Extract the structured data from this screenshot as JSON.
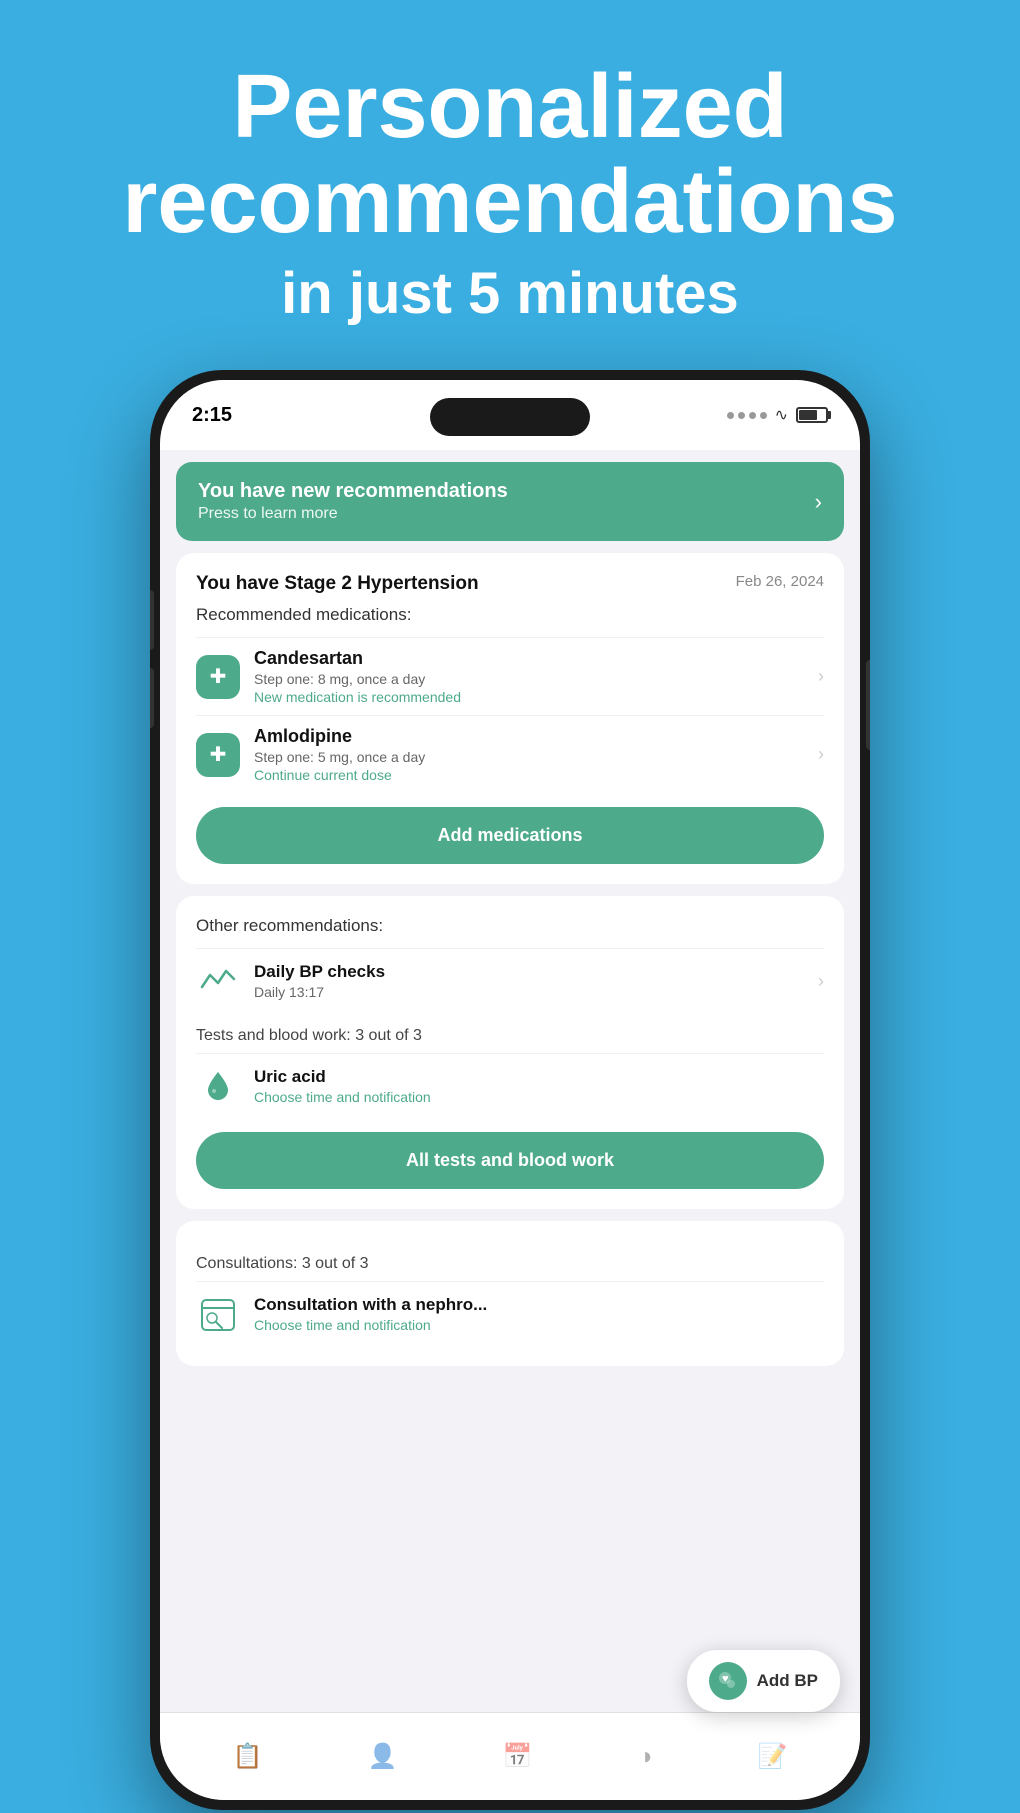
{
  "hero": {
    "title": "Personalized recommendations",
    "subtitle": "in just 5 minutes"
  },
  "status_bar": {
    "time": "2:15"
  },
  "banner": {
    "title": "You have new recommendations",
    "subtitle": "Press to learn more"
  },
  "hypertension_card": {
    "diagnosis": "You have Stage 2 Hypertension",
    "date": "Feb 26, 2024",
    "section_label": "Recommended medications:",
    "medications": [
      {
        "name": "Candesartan",
        "dose": "Step one: 8 mg, once a day",
        "status": "New medication is recommended",
        "status_type": "new"
      },
      {
        "name": "Amlodipine",
        "dose": "Step one: 5 mg, once a day",
        "status": "Continue current dose",
        "status_type": "continue"
      }
    ],
    "add_button": "Add medications"
  },
  "other_recommendations_card": {
    "section_label": "Other recommendations:",
    "bp_item": {
      "name": "Daily BP checks",
      "schedule": "Daily 13:17"
    },
    "tests_label": "Tests and blood work: 3 out of 3",
    "uric_item": {
      "name": "Uric acid",
      "action": "Choose time and notification"
    },
    "all_tests_button": "All tests and blood work"
  },
  "consultations_card": {
    "label": "Consultations: 3 out of 3",
    "item": {
      "name": "Consultation with a nephro...",
      "action": "Choose time and notification"
    }
  },
  "add_bp_button": "Add BP",
  "bottom_nav": {
    "items": [
      {
        "label": "",
        "icon": "clipboard"
      },
      {
        "label": "",
        "icon": "person"
      },
      {
        "label": "",
        "icon": "calendar"
      },
      {
        "label": "",
        "icon": "chart"
      },
      {
        "label": "",
        "icon": "notes"
      }
    ]
  }
}
